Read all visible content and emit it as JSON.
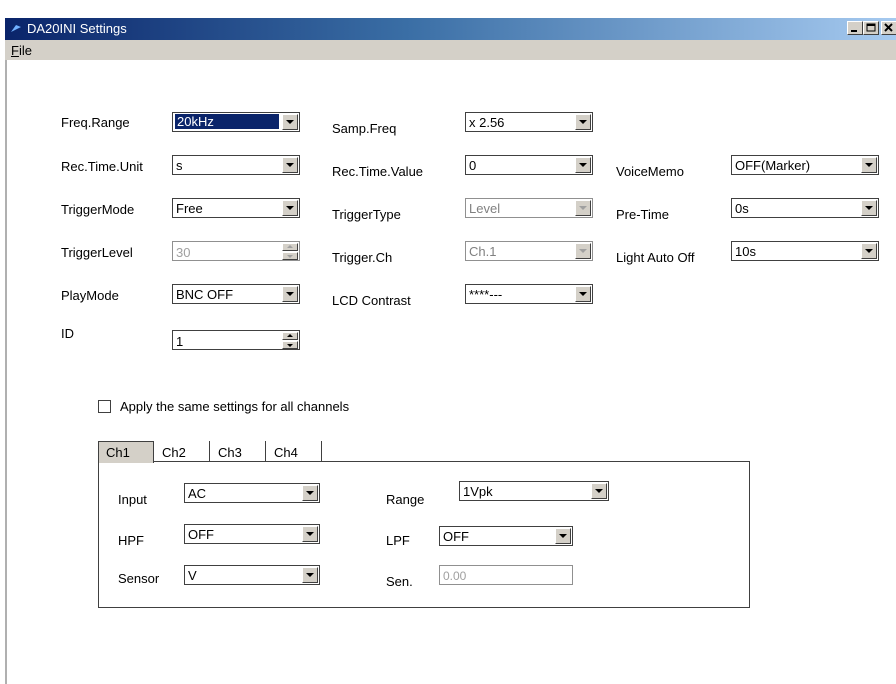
{
  "window": {
    "title": "DA20INI Settings"
  },
  "menu": {
    "file": "File",
    "file_underline": "F",
    "file_rest": "ile"
  },
  "fields": {
    "freq_range": {
      "label": "Freq.Range",
      "value": "20kHz"
    },
    "samp_freq": {
      "label": "Samp.Freq",
      "value": "x 2.56"
    },
    "rec_time_unit": {
      "label": "Rec.Time.Unit",
      "value": "s"
    },
    "rec_time_value": {
      "label": "Rec.Time.Value",
      "value": "0"
    },
    "voice_memo": {
      "label": "VoiceMemo",
      "value": "OFF(Marker)"
    },
    "trigger_mode": {
      "label": "TriggerMode",
      "value": "Free"
    },
    "trigger_type": {
      "label": "TriggerType",
      "value": "Level"
    },
    "pre_time": {
      "label": "Pre-Time",
      "value": "0s"
    },
    "trigger_level": {
      "label": "TriggerLevel",
      "value": "30"
    },
    "trigger_ch": {
      "label": "Trigger.Ch",
      "value": "Ch.1"
    },
    "light_auto_off": {
      "label": "Light Auto Off",
      "value": "10s"
    },
    "play_mode": {
      "label": "PlayMode",
      "value": "BNC OFF"
    },
    "lcd_contrast": {
      "label": "LCD Contrast",
      "value": "****---"
    },
    "id": {
      "label": "ID",
      "value": "1"
    }
  },
  "apply_all": {
    "label": "Apply the same settings for all channels",
    "checked": false
  },
  "tabs": [
    "Ch1",
    "Ch2",
    "Ch3",
    "Ch4"
  ],
  "channel": {
    "input": {
      "label": "Input",
      "value": "AC"
    },
    "range": {
      "label": "Range",
      "value": "1Vpk"
    },
    "hpf": {
      "label": "HPF",
      "value": "OFF"
    },
    "lpf": {
      "label": "LPF",
      "value": "OFF"
    },
    "sensor": {
      "label": "Sensor",
      "value": "V"
    },
    "sen": {
      "label": "Sen.",
      "value": "0.00"
    }
  },
  "colors": {
    "titlebar_start": "#0a246a",
    "titlebar_end": "#a6caf0",
    "face": "#d4d0c8"
  }
}
